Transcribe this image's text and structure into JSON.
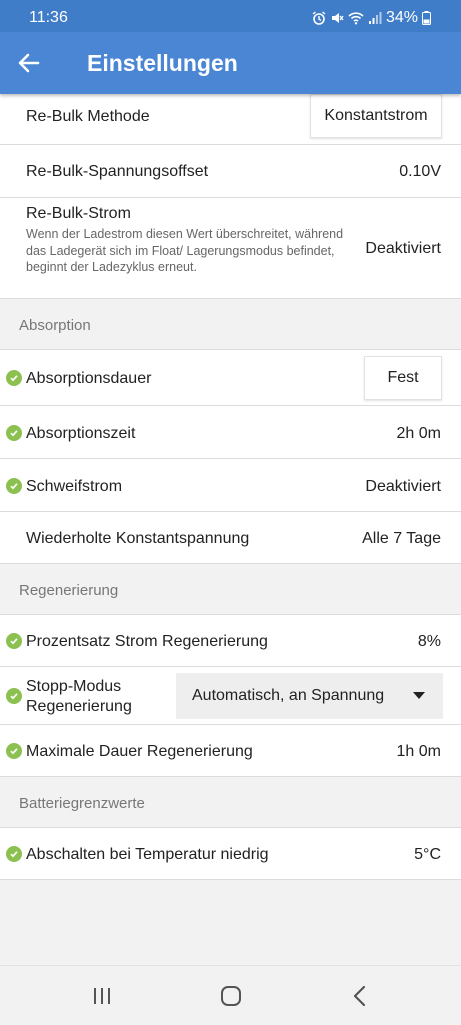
{
  "status": {
    "time": "11:36",
    "battery": "34%"
  },
  "appbar": {
    "title": "Einstellungen"
  },
  "rows": {
    "rebulk_method": {
      "label": "Re-Bulk Methode",
      "value": "Konstantstrom"
    },
    "rebulk_offset": {
      "label": "Re-Bulk-Spannungsoffset",
      "value": "0.10V"
    },
    "rebulk_current": {
      "label": "Re-Bulk-Strom",
      "description": "Wenn der Ladestrom diesen Wert überschreitet, während das Ladegerät sich im Float/ Lagerungsmodus befindet, beginnt der Ladezyklus erneut.",
      "value": "Deaktiviert"
    }
  },
  "sections": {
    "absorption": {
      "title": "Absorption",
      "rows": {
        "duration": {
          "label": "Absorptionsdauer",
          "value": "Fest"
        },
        "time": {
          "label": "Absorptionszeit",
          "value": "2h 0m"
        },
        "tail": {
          "label": "Schweifstrom",
          "value": "Deaktiviert"
        },
        "repeat": {
          "label": "Wiederholte Konstantspannung",
          "value": "Alle 7 Tage"
        }
      }
    },
    "regeneration": {
      "title": "Regenerierung",
      "rows": {
        "percent": {
          "label": "Prozentsatz Strom Regenerierung",
          "value": "8%"
        },
        "stop_mode": {
          "label_line1": "Stopp-Modus",
          "label_line2": "Regenerierung",
          "value": "Automatisch, an Spannung"
        },
        "max_duration": {
          "label": "Maximale Dauer Regenerierung",
          "value": "1h 0m"
        }
      }
    },
    "battery_limits": {
      "title": "Batteriegrenzwerte",
      "rows": {
        "low_temp": {
          "label": "Abschalten bei Temperatur niedrig",
          "value": "5°C"
        }
      }
    }
  },
  "colors": {
    "accent": "#4a86d4",
    "statusbar": "#3f7dc8",
    "check": "#8cc152"
  },
  "icons": [
    "back-arrow-icon",
    "alarm-icon",
    "mute-icon",
    "wifi-icon",
    "signal-icon",
    "battery-icon",
    "check-icon",
    "dropdown-arrow-icon",
    "recents-icon",
    "home-icon",
    "back-icon"
  ]
}
